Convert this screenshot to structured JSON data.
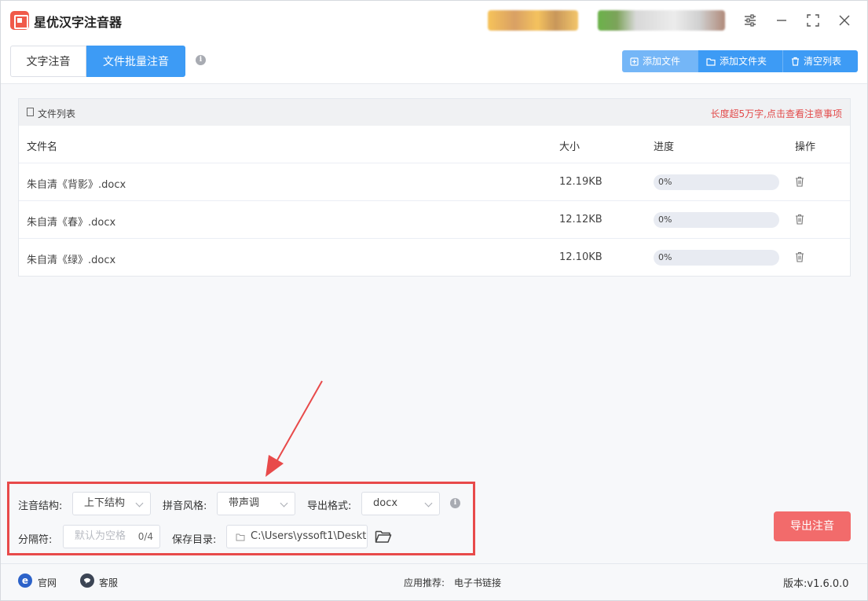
{
  "app": {
    "title": "星优汉字注音器"
  },
  "tabs": [
    {
      "label": "文字注音",
      "active": false
    },
    {
      "label": "文件批量注音",
      "active": true
    }
  ],
  "toolbar": {
    "add_file": "添加文件",
    "add_folder": "添加文件夹",
    "clear_list": "清空列表"
  },
  "file_list": {
    "title": "文件列表",
    "notice": "长度超5万字,点击查看注意事项",
    "columns": {
      "name": "文件名",
      "size": "大小",
      "progress": "进度",
      "action": "操作"
    },
    "rows": [
      {
        "name": "朱自清《背影》.docx",
        "size": "12.19KB",
        "progress": "0%",
        "progress_value": 0
      },
      {
        "name": "朱自清《春》.docx",
        "size": "12.12KB",
        "progress": "0%",
        "progress_value": 0
      },
      {
        "name": "朱自清《绿》.docx",
        "size": "12.10KB",
        "progress": "0%",
        "progress_value": 0
      }
    ]
  },
  "settings": {
    "structure_label": "注音结构:",
    "structure_value": "上下结构",
    "style_label": "拼音风格:",
    "style_value": "带声调",
    "format_label": "导出格式:",
    "format_value": "docx",
    "separator_label": "分隔符:",
    "separator_placeholder": "默认为空格",
    "separator_count": "0/4",
    "savedir_label": "保存目录:",
    "savedir_value": "C:\\Users\\yssoft1\\Deskt"
  },
  "export_button": "导出注音",
  "statusbar": {
    "website": "官网",
    "service": "客服",
    "recommend_label": "应用推荐:",
    "recommend_link": "电子书链接",
    "version": "版本:v1.6.0.0"
  },
  "colors": {
    "accent": "#3d9bf5",
    "export": "#f26b6b",
    "highlight_box": "#e84a4a",
    "notice": "#e24b4b"
  }
}
